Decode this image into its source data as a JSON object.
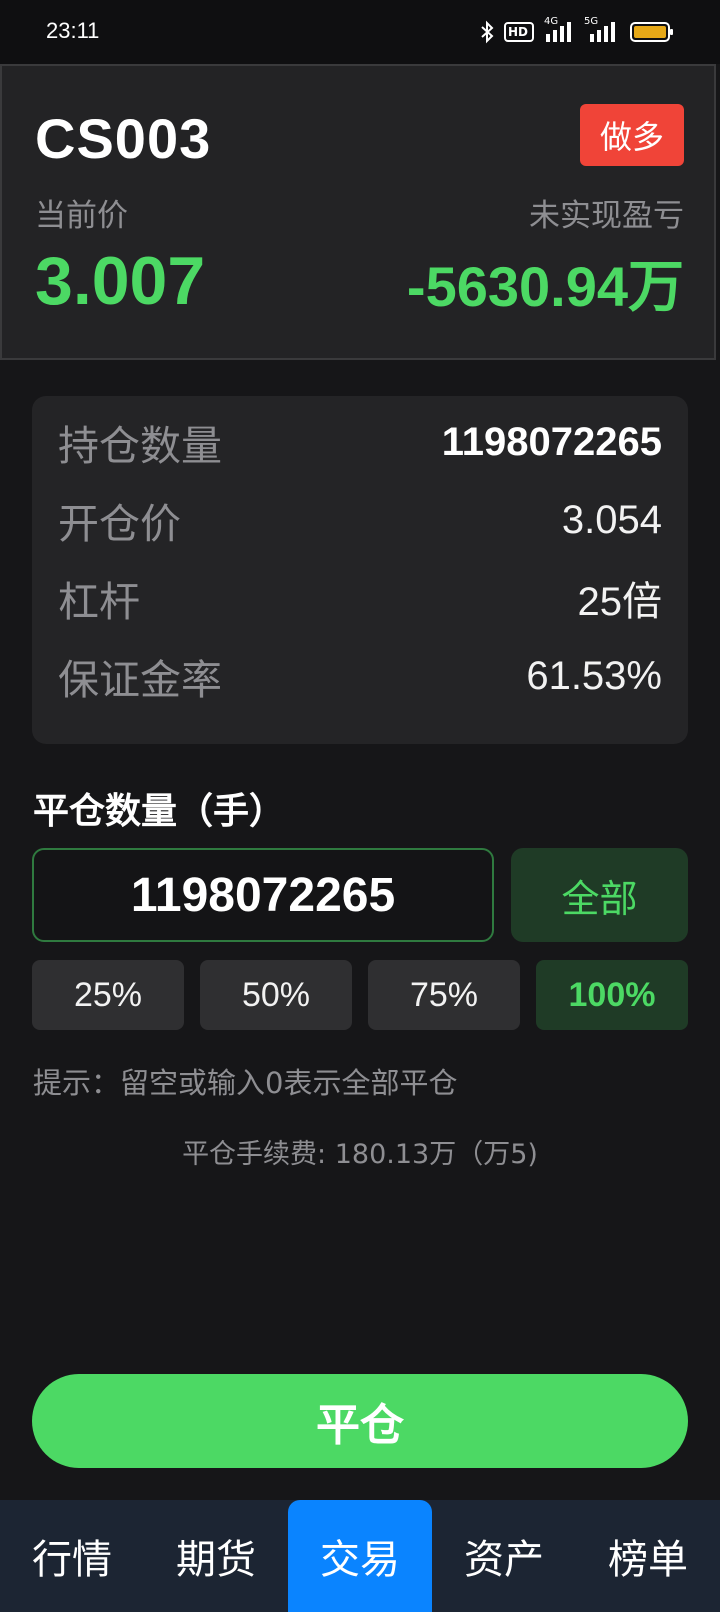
{
  "status_bar": {
    "time": "23:11",
    "icons": [
      "bluetooth-icon",
      "hd-voice-icon",
      "signal-4g-icon",
      "signal-5g-icon",
      "battery-icon"
    ],
    "hd_label": "HD",
    "net1": "4G",
    "net2": "5G"
  },
  "position": {
    "symbol": "CS003",
    "side": "做多",
    "current_price_label": "当前价",
    "current_price": "3.007",
    "unrealized_pnl_label": "未实现盈亏",
    "unrealized_pnl": "-5630.94万"
  },
  "details": [
    {
      "label": "持仓数量",
      "value": "1198072265"
    },
    {
      "label": "开仓价",
      "value": "3.054"
    },
    {
      "label": "杠杆",
      "value": "25倍"
    },
    {
      "label": "保证金率",
      "value": "61.53%"
    }
  ],
  "close_form": {
    "title": "平仓数量（手）",
    "quantity": "1198072265",
    "all_label": "全部",
    "percent_options": [
      "25%",
      "50%",
      "75%",
      "100%"
    ],
    "selected_percent": "100%",
    "hint": "提示：留空或输入0表示全部平仓",
    "fee": "平仓手续费: 180.13万（万5)",
    "submit_label": "平仓"
  },
  "nav": {
    "items": [
      "行情",
      "期货",
      "交易",
      "资产",
      "榜单"
    ],
    "active": "交易"
  },
  "colors": {
    "profit_green": "#4cd964",
    "long_red": "#f04438",
    "nav_active_blue": "#0a84ff",
    "background": "#161618"
  }
}
